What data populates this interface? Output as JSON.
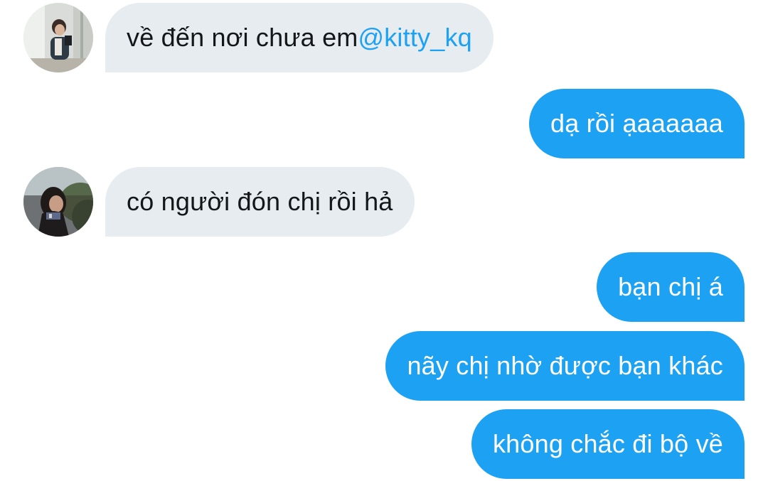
{
  "conversation": {
    "messages": [
      {
        "direction": "incoming",
        "text": "về đến nơi chưa em ",
        "mention": "@kitty_kq",
        "avatar_icon": "user-avatar-photo"
      },
      {
        "direction": "outgoing",
        "text": "dạ rồi ạaaaaaa"
      },
      {
        "direction": "incoming",
        "text": "có người đón chị rồi hả",
        "avatar_icon": "user-avatar-photo"
      },
      {
        "direction": "outgoing",
        "text": "bạn chị á"
      },
      {
        "direction": "outgoing",
        "text": "nãy chị nhờ được bạn khác"
      },
      {
        "direction": "outgoing",
        "text": "không chắc đi bộ về"
      }
    ]
  },
  "colors": {
    "outgoing_bubble": "#1da1f2",
    "incoming_bubble": "#e6ecf0",
    "mention": "#1da1f2",
    "incoming_text": "#14171a",
    "outgoing_text": "#ffffff"
  }
}
